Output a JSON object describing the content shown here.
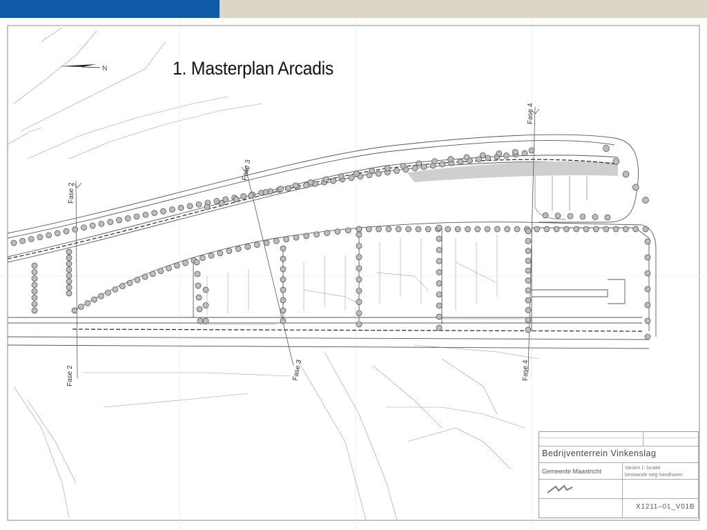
{
  "slide": {
    "title": "1. Masterplan Arcadis",
    "colors": {
      "top_bar_left": "#0e5aa7",
      "top_bar_right": "#ddd6c8"
    }
  },
  "drawing": {
    "north_label": "N",
    "phase_labels": [
      "Fase 2",
      "Fase 3",
      "Fase 4",
      "Fase 2",
      "Fase 3",
      "Fase 4"
    ],
    "title_block": {
      "project": "Bedrijventerrein Vinkenslag",
      "client": "Gemeente Maastricht",
      "variant_line1": "Variant 1: locatie",
      "variant_line2": "bestaande weg handhaven",
      "drawing_code": "X1211–01_V01B"
    }
  }
}
